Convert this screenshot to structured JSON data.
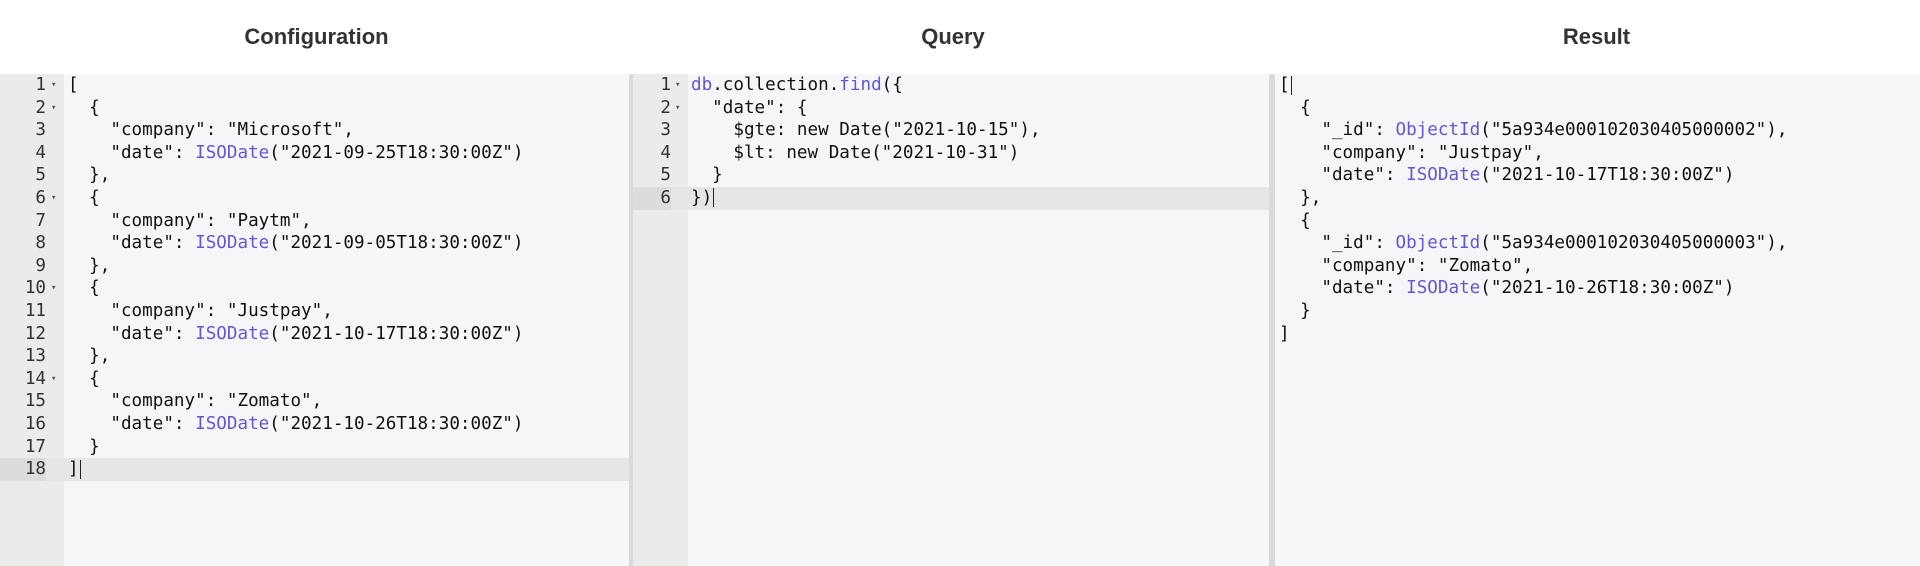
{
  "titles": {
    "configuration": "Configuration",
    "query": "Query",
    "result": "Result"
  },
  "configuration": {
    "active_line": 18,
    "lines": [
      {
        "num": "1",
        "fold": true,
        "segments": [
          {
            "t": "["
          }
        ]
      },
      {
        "num": "2",
        "fold": true,
        "segments": [
          {
            "t": "  {"
          }
        ]
      },
      {
        "num": "3",
        "fold": false,
        "segments": [
          {
            "t": "    \"company\": \"Microsoft\","
          }
        ]
      },
      {
        "num": "4",
        "fold": false,
        "segments": [
          {
            "t": "    \"date\": "
          },
          {
            "t": "ISODate",
            "fn": true
          },
          {
            "t": "(\"2021-09-25T18:30:00Z\")"
          }
        ]
      },
      {
        "num": "5",
        "fold": false,
        "segments": [
          {
            "t": "  },"
          }
        ]
      },
      {
        "num": "6",
        "fold": true,
        "segments": [
          {
            "t": "  {"
          }
        ]
      },
      {
        "num": "7",
        "fold": false,
        "segments": [
          {
            "t": "    \"company\": \"Paytm\","
          }
        ]
      },
      {
        "num": "8",
        "fold": false,
        "segments": [
          {
            "t": "    \"date\": "
          },
          {
            "t": "ISODate",
            "fn": true
          },
          {
            "t": "(\"2021-09-05T18:30:00Z\")"
          }
        ]
      },
      {
        "num": "9",
        "fold": false,
        "segments": [
          {
            "t": "  },"
          }
        ]
      },
      {
        "num": "10",
        "fold": true,
        "segments": [
          {
            "t": "  {"
          }
        ]
      },
      {
        "num": "11",
        "fold": false,
        "segments": [
          {
            "t": "    \"company\": \"Justpay\","
          }
        ]
      },
      {
        "num": "12",
        "fold": false,
        "segments": [
          {
            "t": "    \"date\": "
          },
          {
            "t": "ISODate",
            "fn": true
          },
          {
            "t": "(\"2021-10-17T18:30:00Z\")"
          }
        ]
      },
      {
        "num": "13",
        "fold": false,
        "segments": [
          {
            "t": "  },"
          }
        ]
      },
      {
        "num": "14",
        "fold": true,
        "segments": [
          {
            "t": "  {"
          }
        ]
      },
      {
        "num": "15",
        "fold": false,
        "segments": [
          {
            "t": "    \"company\": \"Zomato\","
          }
        ]
      },
      {
        "num": "16",
        "fold": false,
        "segments": [
          {
            "t": "    \"date\": "
          },
          {
            "t": "ISODate",
            "fn": true
          },
          {
            "t": "(\"2021-10-26T18:30:00Z\")"
          }
        ]
      },
      {
        "num": "17",
        "fold": false,
        "segments": [
          {
            "t": "  }"
          }
        ]
      },
      {
        "num": "18",
        "fold": false,
        "segments": [
          {
            "t": "]"
          }
        ],
        "cursor": true
      }
    ]
  },
  "query": {
    "active_line": 6,
    "lines": [
      {
        "num": "1",
        "fold": true,
        "segments": [
          {
            "t": "db",
            "fn": true
          },
          {
            "t": ".collection."
          },
          {
            "t": "find",
            "fn": true
          },
          {
            "t": "({"
          }
        ]
      },
      {
        "num": "2",
        "fold": true,
        "segments": [
          {
            "t": "  \"date\": {"
          }
        ]
      },
      {
        "num": "3",
        "fold": false,
        "segments": [
          {
            "t": "    $gte: new Date(\"2021-10-15\"),"
          }
        ]
      },
      {
        "num": "4",
        "fold": false,
        "segments": [
          {
            "t": "    $lt: new Date(\"2021-10-31\")"
          }
        ]
      },
      {
        "num": "5",
        "fold": false,
        "segments": [
          {
            "t": "  }"
          }
        ]
      },
      {
        "num": "6",
        "fold": false,
        "segments": [
          {
            "t": "})"
          }
        ],
        "cursor": true
      }
    ]
  },
  "result": {
    "lines": [
      {
        "segments": [
          {
            "t": "["
          }
        ],
        "cursor": true
      },
      {
        "segments": [
          {
            "t": "  {"
          }
        ]
      },
      {
        "segments": [
          {
            "t": "    \"_id\": "
          },
          {
            "t": "ObjectId",
            "fn": true
          },
          {
            "t": "(\"5a934e000102030405000002\"),"
          }
        ]
      },
      {
        "segments": [
          {
            "t": "    \"company\": \"Justpay\","
          }
        ]
      },
      {
        "segments": [
          {
            "t": "    \"date\": "
          },
          {
            "t": "ISODate",
            "fn": true
          },
          {
            "t": "(\"2021-10-17T18:30:00Z\")"
          }
        ]
      },
      {
        "segments": [
          {
            "t": "  },"
          }
        ]
      },
      {
        "segments": [
          {
            "t": "  {"
          }
        ]
      },
      {
        "segments": [
          {
            "t": "    \"_id\": "
          },
          {
            "t": "ObjectId",
            "fn": true
          },
          {
            "t": "(\"5a934e000102030405000003\"),"
          }
        ]
      },
      {
        "segments": [
          {
            "t": "    \"company\": \"Zomato\","
          }
        ]
      },
      {
        "segments": [
          {
            "t": "    \"date\": "
          },
          {
            "t": "ISODate",
            "fn": true
          },
          {
            "t": "(\"2021-10-26T18:30:00Z\")"
          }
        ]
      },
      {
        "segments": [
          {
            "t": "  }"
          }
        ]
      },
      {
        "segments": [
          {
            "t": "]"
          }
        ]
      }
    ]
  }
}
